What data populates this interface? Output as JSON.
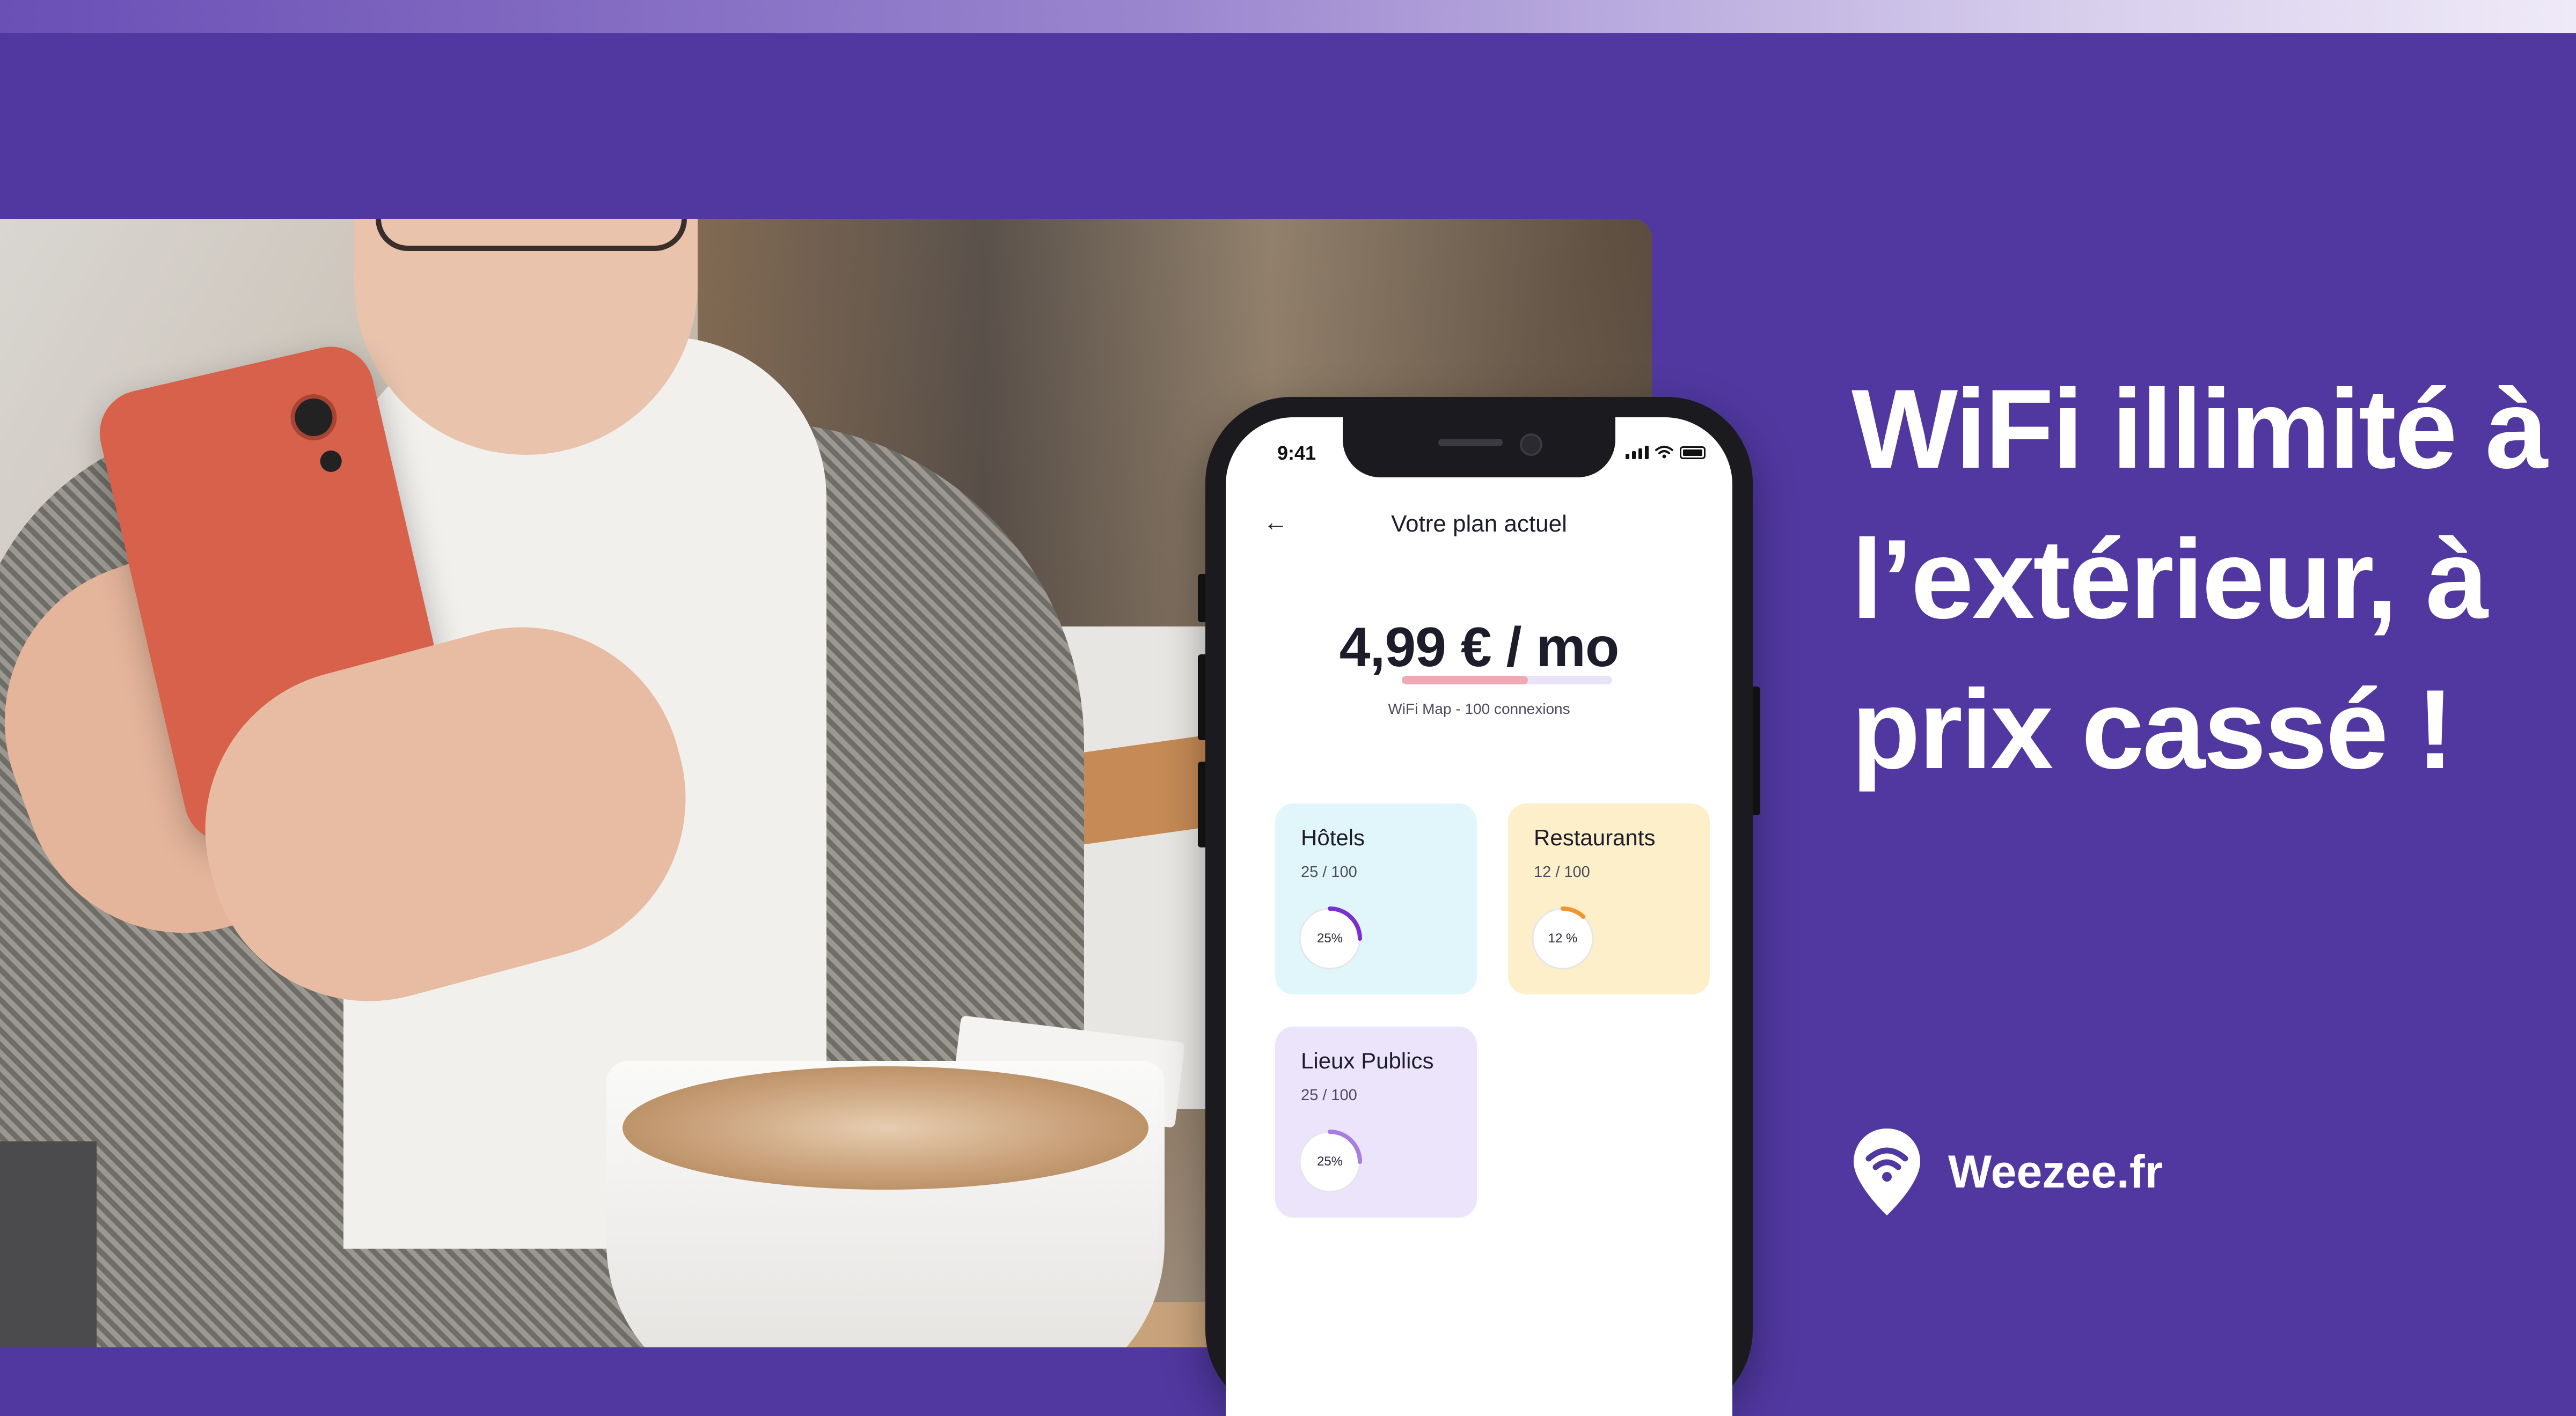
{
  "headline": {
    "line1": "WiFi illimité à",
    "line2": "l’extérieur, à",
    "line3": "prix cassé !"
  },
  "brand": {
    "name": "Weezee.fr",
    "logo_icon": "wifi-location-pin-icon"
  },
  "phone": {
    "status_time": "9:41",
    "screen_title": "Votre plan actuel",
    "price": "4,99 € / mo",
    "plan_description": "WiFi Map - 100 connexions",
    "plan_progress": 0.6,
    "cards": [
      {
        "title": "Hôtels",
        "count": "25 / 100",
        "percent_label": "25%",
        "percent": 25,
        "ring_color": "#7b2fd0",
        "background": "#e1f6fa"
      },
      {
        "title": "Restaurants",
        "count": "12 / 100",
        "percent_label": "12 %",
        "percent": 12,
        "ring_color": "#f3952d",
        "background": "#fdefca"
      },
      {
        "title": "Lieux Publics",
        "count": "25 / 100",
        "percent_label": "25%",
        "percent": 25,
        "ring_color": "#a77de0",
        "background": "#ebe4fb"
      }
    ]
  },
  "colors": {
    "background": "#5038a0",
    "plan_bar_fill": "#f0a9b6",
    "plan_bar_track": "#e9e3f7"
  }
}
